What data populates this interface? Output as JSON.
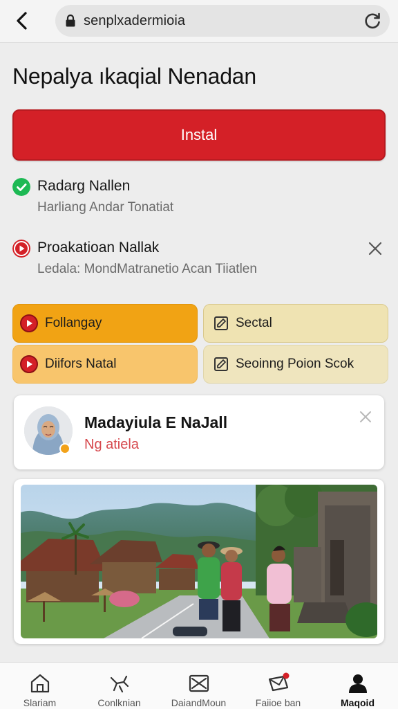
{
  "browser": {
    "url": "senplxadermioia"
  },
  "page": {
    "title": "Nepalya ıkaqial Nenadan",
    "install_label": "Instal"
  },
  "info_rows": [
    {
      "title": "Radarg Nallen",
      "subtitle": "Harliang Andar Tonatiat",
      "status": "check"
    },
    {
      "title": "Proakatioan Nallak",
      "subtitle": "Ledala: MondMatranetio Acan Tiiatlen",
      "status": "play"
    }
  ],
  "tiles": [
    {
      "label": "Follangay",
      "icon": "play-icon"
    },
    {
      "label": "Sectal",
      "icon": "edit-icon"
    },
    {
      "label": "Diifors Natal",
      "icon": "play-icon"
    },
    {
      "label": "Seoinng Poion Scok",
      "icon": "edit-icon"
    }
  ],
  "profile": {
    "name": "Madayiula E NaJall",
    "subtitle": "Ng atiela"
  },
  "bottom_nav": [
    {
      "label": "Slariam",
      "icon": "home-icon"
    },
    {
      "label": "Conlknian",
      "icon": "bird-icon"
    },
    {
      "label": "DaiandMoun",
      "icon": "mail-box-icon"
    },
    {
      "label": "Faiioe ban",
      "icon": "mail-notification-icon"
    },
    {
      "label": "Maqoid",
      "icon": "person-icon",
      "active": true
    }
  ],
  "colors": {
    "accent_red": "#d42027",
    "tile_orange": "#f1a314",
    "tile_cream": "#efe3b2",
    "success_green": "#1db954",
    "status_dot": "#f2a21a"
  }
}
